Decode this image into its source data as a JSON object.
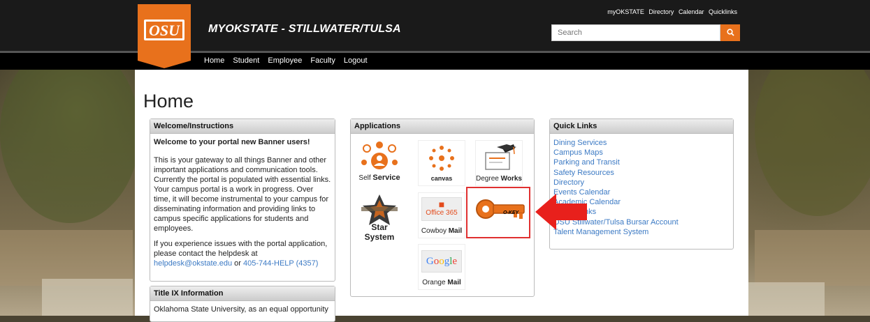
{
  "header": {
    "site_title": "MYOKSTATE - STILLWATER/TULSA",
    "logo_text": "OSU",
    "utility_links": [
      "myOKSTATE",
      "Directory",
      "Calendar",
      "Quicklinks"
    ],
    "search_placeholder": "Search"
  },
  "nav": [
    "Home",
    "Student",
    "Employee",
    "Faculty",
    "Logout"
  ],
  "page_title": "Home",
  "welcome": {
    "heading": "Welcome/Instructions",
    "bold_line": "Welcome to your portal new Banner users!",
    "para1": "This is your gateway to all things Banner and other important applications and communication tools. Currently the portal is populated with essential links. Your campus portal is a work in progress. Over time, it will become instrumental to your campus for disseminating information and providing links to campus specific applications for students and employees.",
    "para2_prefix": "If you experience issues with the portal application, please contact the helpdesk at",
    "email": "helpdesk@okstate.edu",
    "or": "or",
    "phone": "405-744-HELP (4357)"
  },
  "title_ix": {
    "heading": "Title IX Information",
    "text": "Oklahoma State University, as an equal opportunity"
  },
  "applications": {
    "heading": "Applications",
    "tiles": [
      {
        "label_plain": "Self ",
        "label_bold": "Service"
      },
      {
        "label_plain": "",
        "label_bold": "canvas"
      },
      {
        "label_plain": "Degree ",
        "label_bold": "Works"
      },
      {
        "label_plain": "",
        "label_bold": "Star System"
      },
      {
        "label_plain": "Cowboy ",
        "label_bold": "Mail",
        "logo_text": "Office 365"
      },
      {
        "label_plain": "",
        "label_bold": "O-KEY"
      },
      {
        "label_plain": "Orange ",
        "label_bold": "Mail",
        "logo_text": "Google"
      }
    ]
  },
  "quick_links": {
    "heading": "Quick Links",
    "items": [
      "Dining Services",
      "Campus Maps",
      "Parking and Transit",
      "Safety Resources",
      "Directory",
      "Events Calendar",
      "Academic Calendar",
      "Bursar Links",
      "OSU Stillwater/Tulsa Bursar Account",
      "Talent Management System"
    ]
  },
  "colors": {
    "brand_orange": "#e8711c",
    "link": "#3c7ac4",
    "highlight_red": "#e03030"
  }
}
